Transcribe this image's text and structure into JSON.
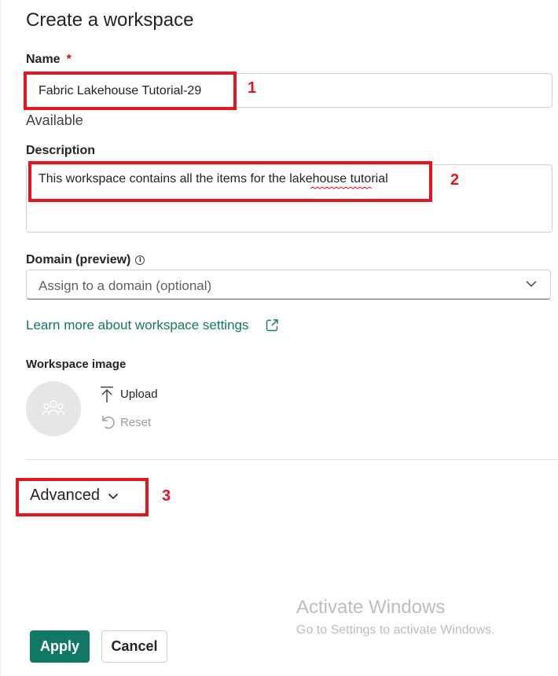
{
  "panel": {
    "title": "Create a workspace"
  },
  "name_field": {
    "label": "Name",
    "required_mark": "*",
    "value": "Fabric Lakehouse Tutorial-29",
    "status": "Available"
  },
  "description_field": {
    "label": "Description",
    "value": "This workspace contains all the items for the lakehouse tutorial"
  },
  "domain_field": {
    "label": "Domain (preview)",
    "info_icon": "info-icon",
    "placeholder": "Assign to a domain (optional)"
  },
  "learn_more": {
    "text": "Learn more about workspace settings",
    "icon": "open-in-new-icon"
  },
  "workspace_image": {
    "label": "Workspace image",
    "avatar_icon": "people-group-icon",
    "upload_label": "Upload",
    "reset_label": "Reset"
  },
  "advanced": {
    "label": "Advanced"
  },
  "annotations": [
    "1",
    "2",
    "3"
  ],
  "watermark": {
    "title": "Activate Windows",
    "subtitle": "Go to Settings to activate Windows."
  },
  "actions": {
    "apply_label": "Apply",
    "cancel_label": "Cancel"
  },
  "colors": {
    "accent": "#117865",
    "annotation": "#e3161d",
    "required": "#c50f1f"
  }
}
